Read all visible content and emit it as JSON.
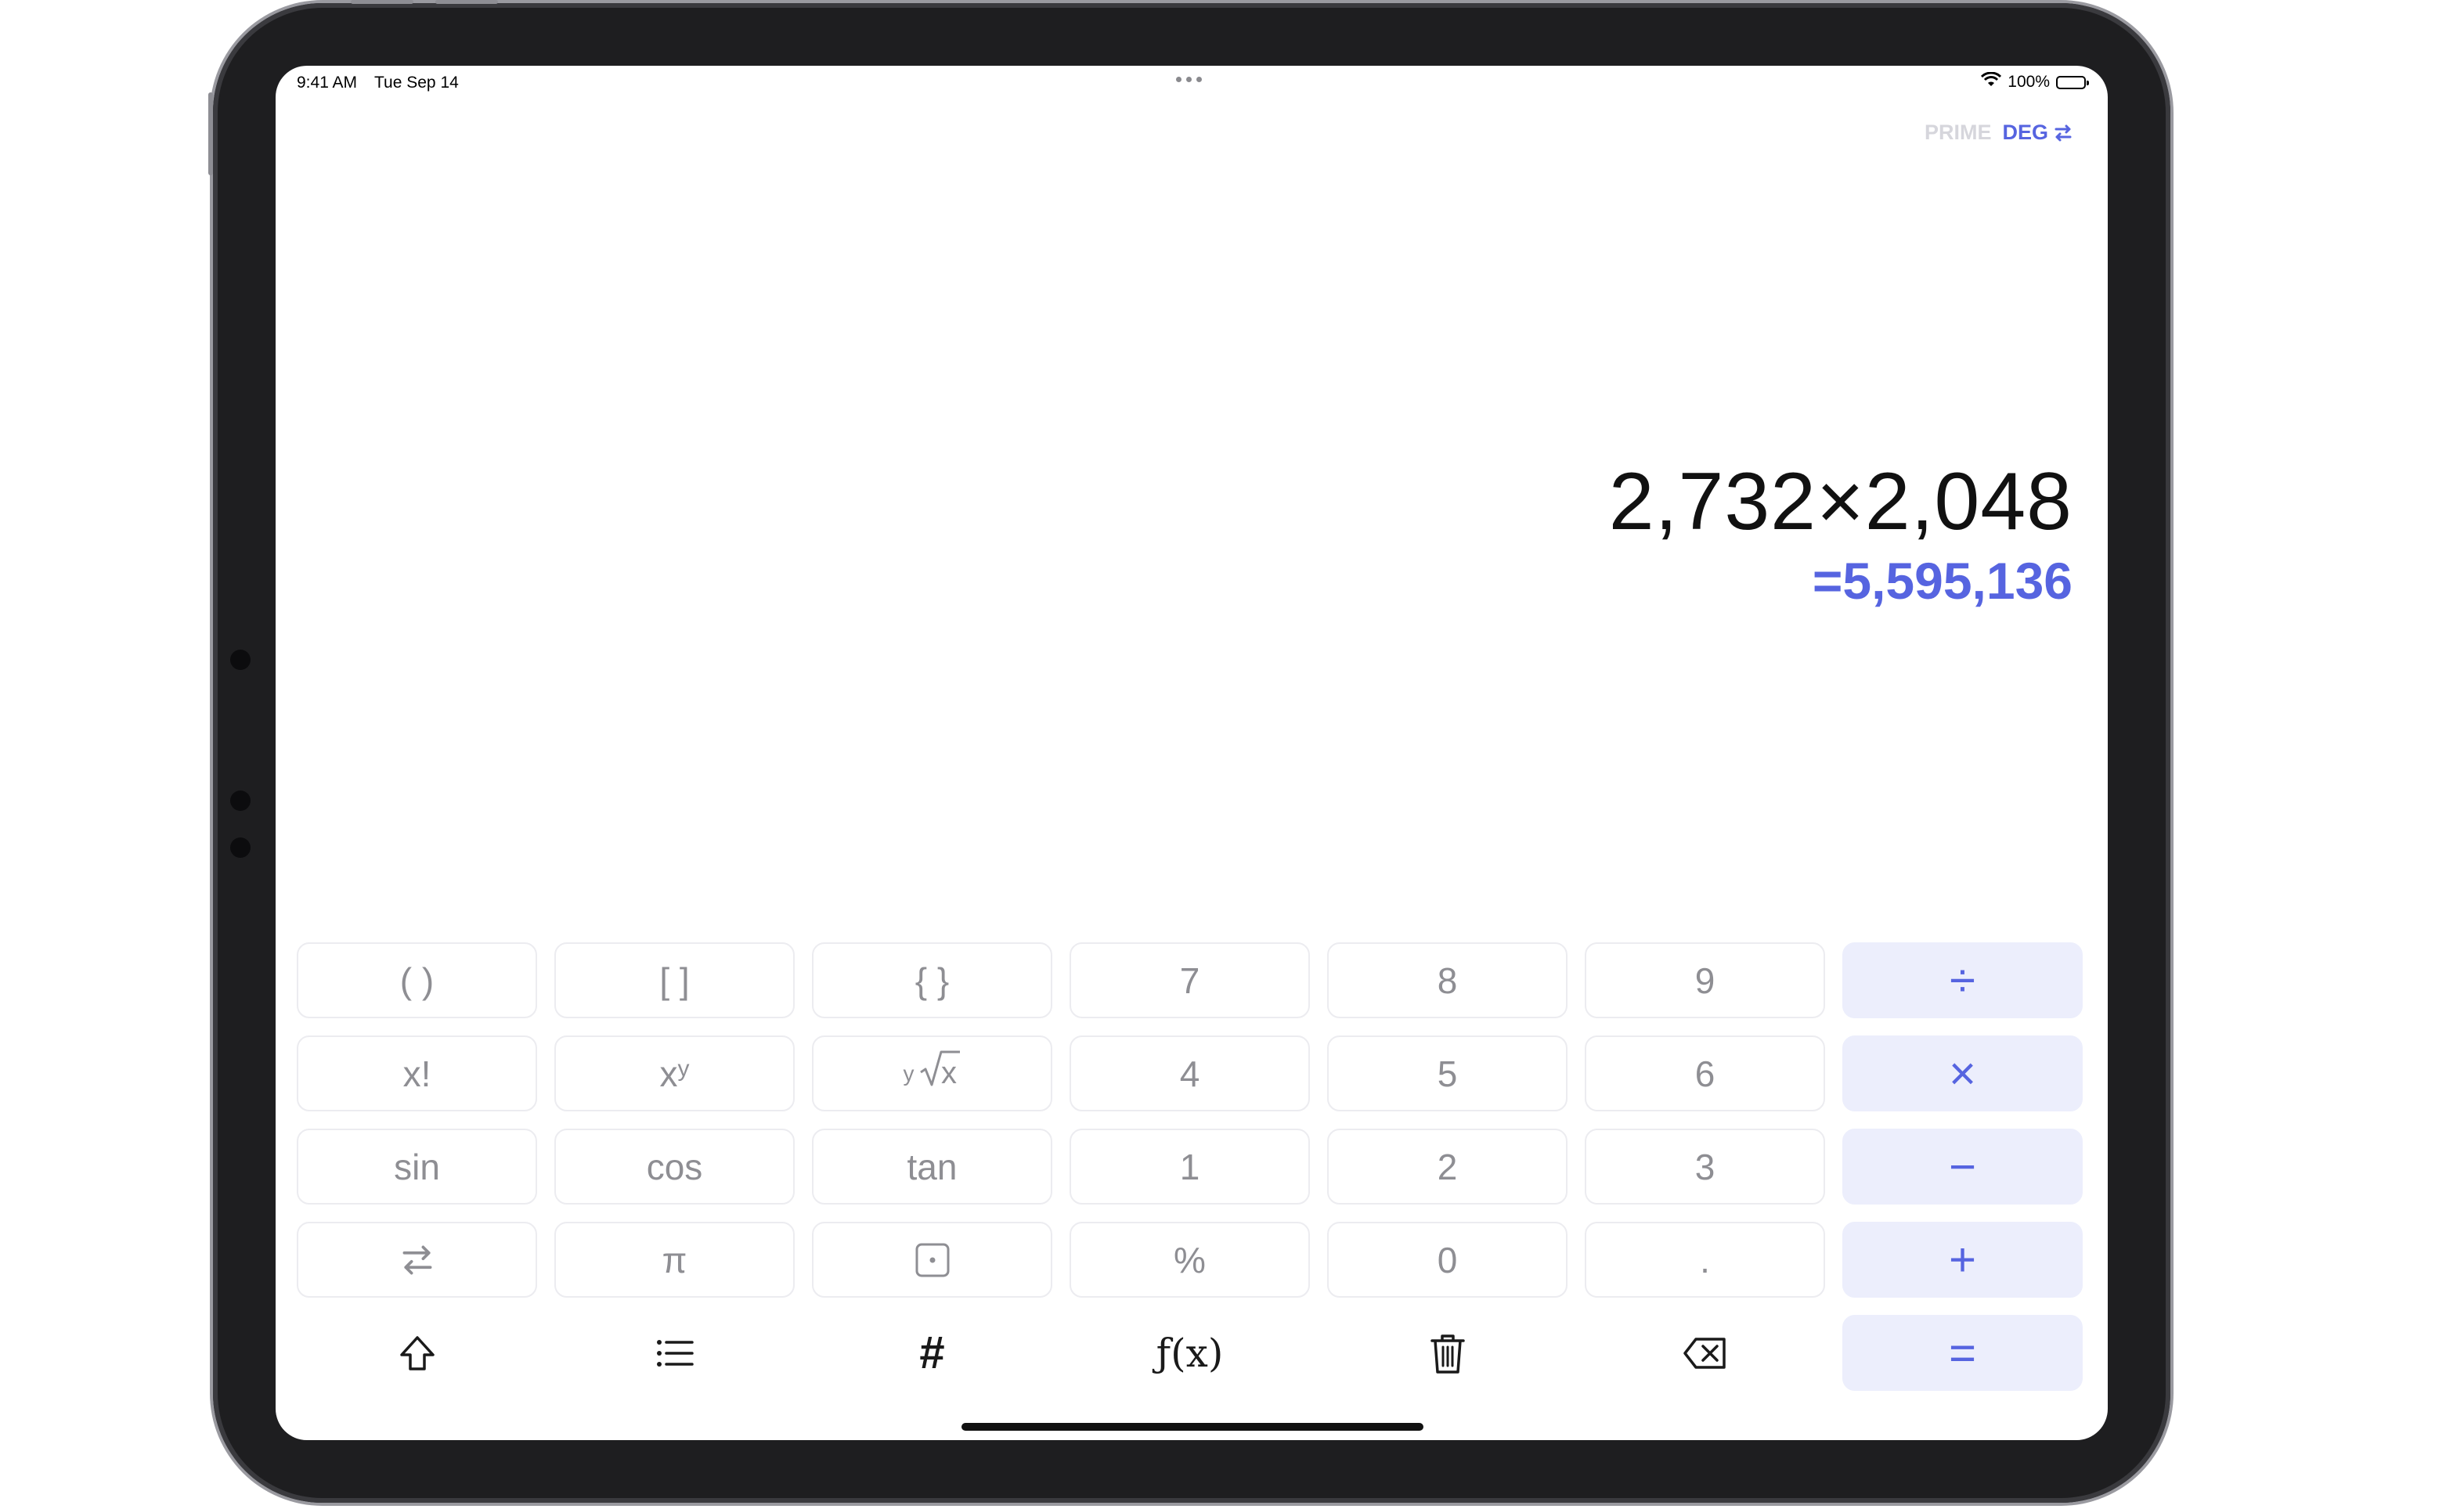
{
  "status_bar": {
    "time": "9:41 AM",
    "date": "Tue Sep 14",
    "battery": "100%"
  },
  "mode": {
    "prime_label": "PRIME",
    "deg_label": "DEG",
    "accent": "#5664e0"
  },
  "display": {
    "expression": "2,732×2,048",
    "result": "=5,595,136"
  },
  "keypad": {
    "row1": [
      "( )",
      "[ ]",
      "{ }",
      "7",
      "8",
      "9",
      "÷"
    ],
    "row2": [
      "x!",
      "x",
      "y",
      "4",
      "5",
      "6",
      "×"
    ],
    "row3": [
      "sin",
      "cos",
      "tan",
      "1",
      "2",
      "3",
      "−"
    ],
    "row4": [
      "⇆",
      "π",
      "·",
      "%",
      "0",
      ".",
      "+"
    ],
    "power_sup": "y",
    "root_x": "x",
    "function_label": "ƒ(x)",
    "hash_label": "#",
    "equals": "="
  },
  "icons": {
    "shift": "shift-icon",
    "list": "list-icon",
    "hash": "hash-icon",
    "function": "function-icon",
    "trash": "trash-icon",
    "backspace": "backspace-icon",
    "swap": "swap-icon",
    "wifi": "wifi-icon",
    "battery": "battery-icon"
  }
}
